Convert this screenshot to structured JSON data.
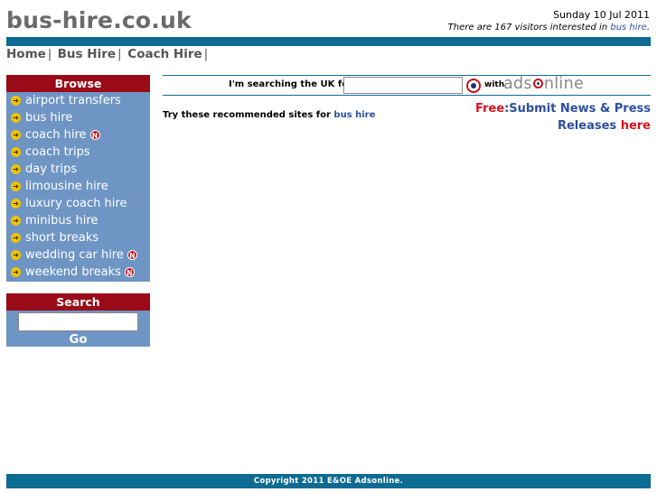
{
  "site": {
    "logo": "bus-hire.co.uk"
  },
  "header": {
    "date": "Sunday 10 Jul 2011",
    "visitors_prefix": "There are 167 visitors interested in ",
    "visitors_link": "bus hire",
    "visitors_suffix": "."
  },
  "nav": [
    {
      "label": "Home"
    },
    {
      "label": "Bus Hire"
    },
    {
      "label": "Coach Hire"
    }
  ],
  "browse": {
    "title": "Browse",
    "items": [
      {
        "label": "airport transfers",
        "new": false
      },
      {
        "label": "bus hire",
        "new": false
      },
      {
        "label": "coach hire",
        "new": true
      },
      {
        "label": "coach trips",
        "new": false
      },
      {
        "label": "day trips",
        "new": false
      },
      {
        "label": "limousine hire",
        "new": false
      },
      {
        "label": "luxury coach hire",
        "new": false
      },
      {
        "label": "minibus hire",
        "new": false
      },
      {
        "label": "short breaks",
        "new": false
      },
      {
        "label": "wedding car hire",
        "new": true
      },
      {
        "label": "weekend breaks",
        "new": true
      }
    ],
    "new_badge": "N"
  },
  "search_panel": {
    "title": "Search",
    "go_label": "Go",
    "value": ""
  },
  "main_search": {
    "label": "I'm searching the UK for...",
    "value": "",
    "with": "with",
    "brand_before": "ads",
    "brand_after": "nline"
  },
  "promo": {
    "free": "Free",
    "line1": ":Submit News & Press",
    "line2": "Releases ",
    "here": "here"
  },
  "recommend": {
    "text": "Try these recommended sites for ",
    "link": "bus hire"
  },
  "footer": {
    "text": "Copyright 2011 E&OE Adsonline."
  },
  "colors": {
    "accent_bar": "#0e6b92",
    "panel_head": "#9b0b17",
    "panel_bg": "#6e95c4",
    "link": "#2c4f9e",
    "red": "#d6131d"
  }
}
